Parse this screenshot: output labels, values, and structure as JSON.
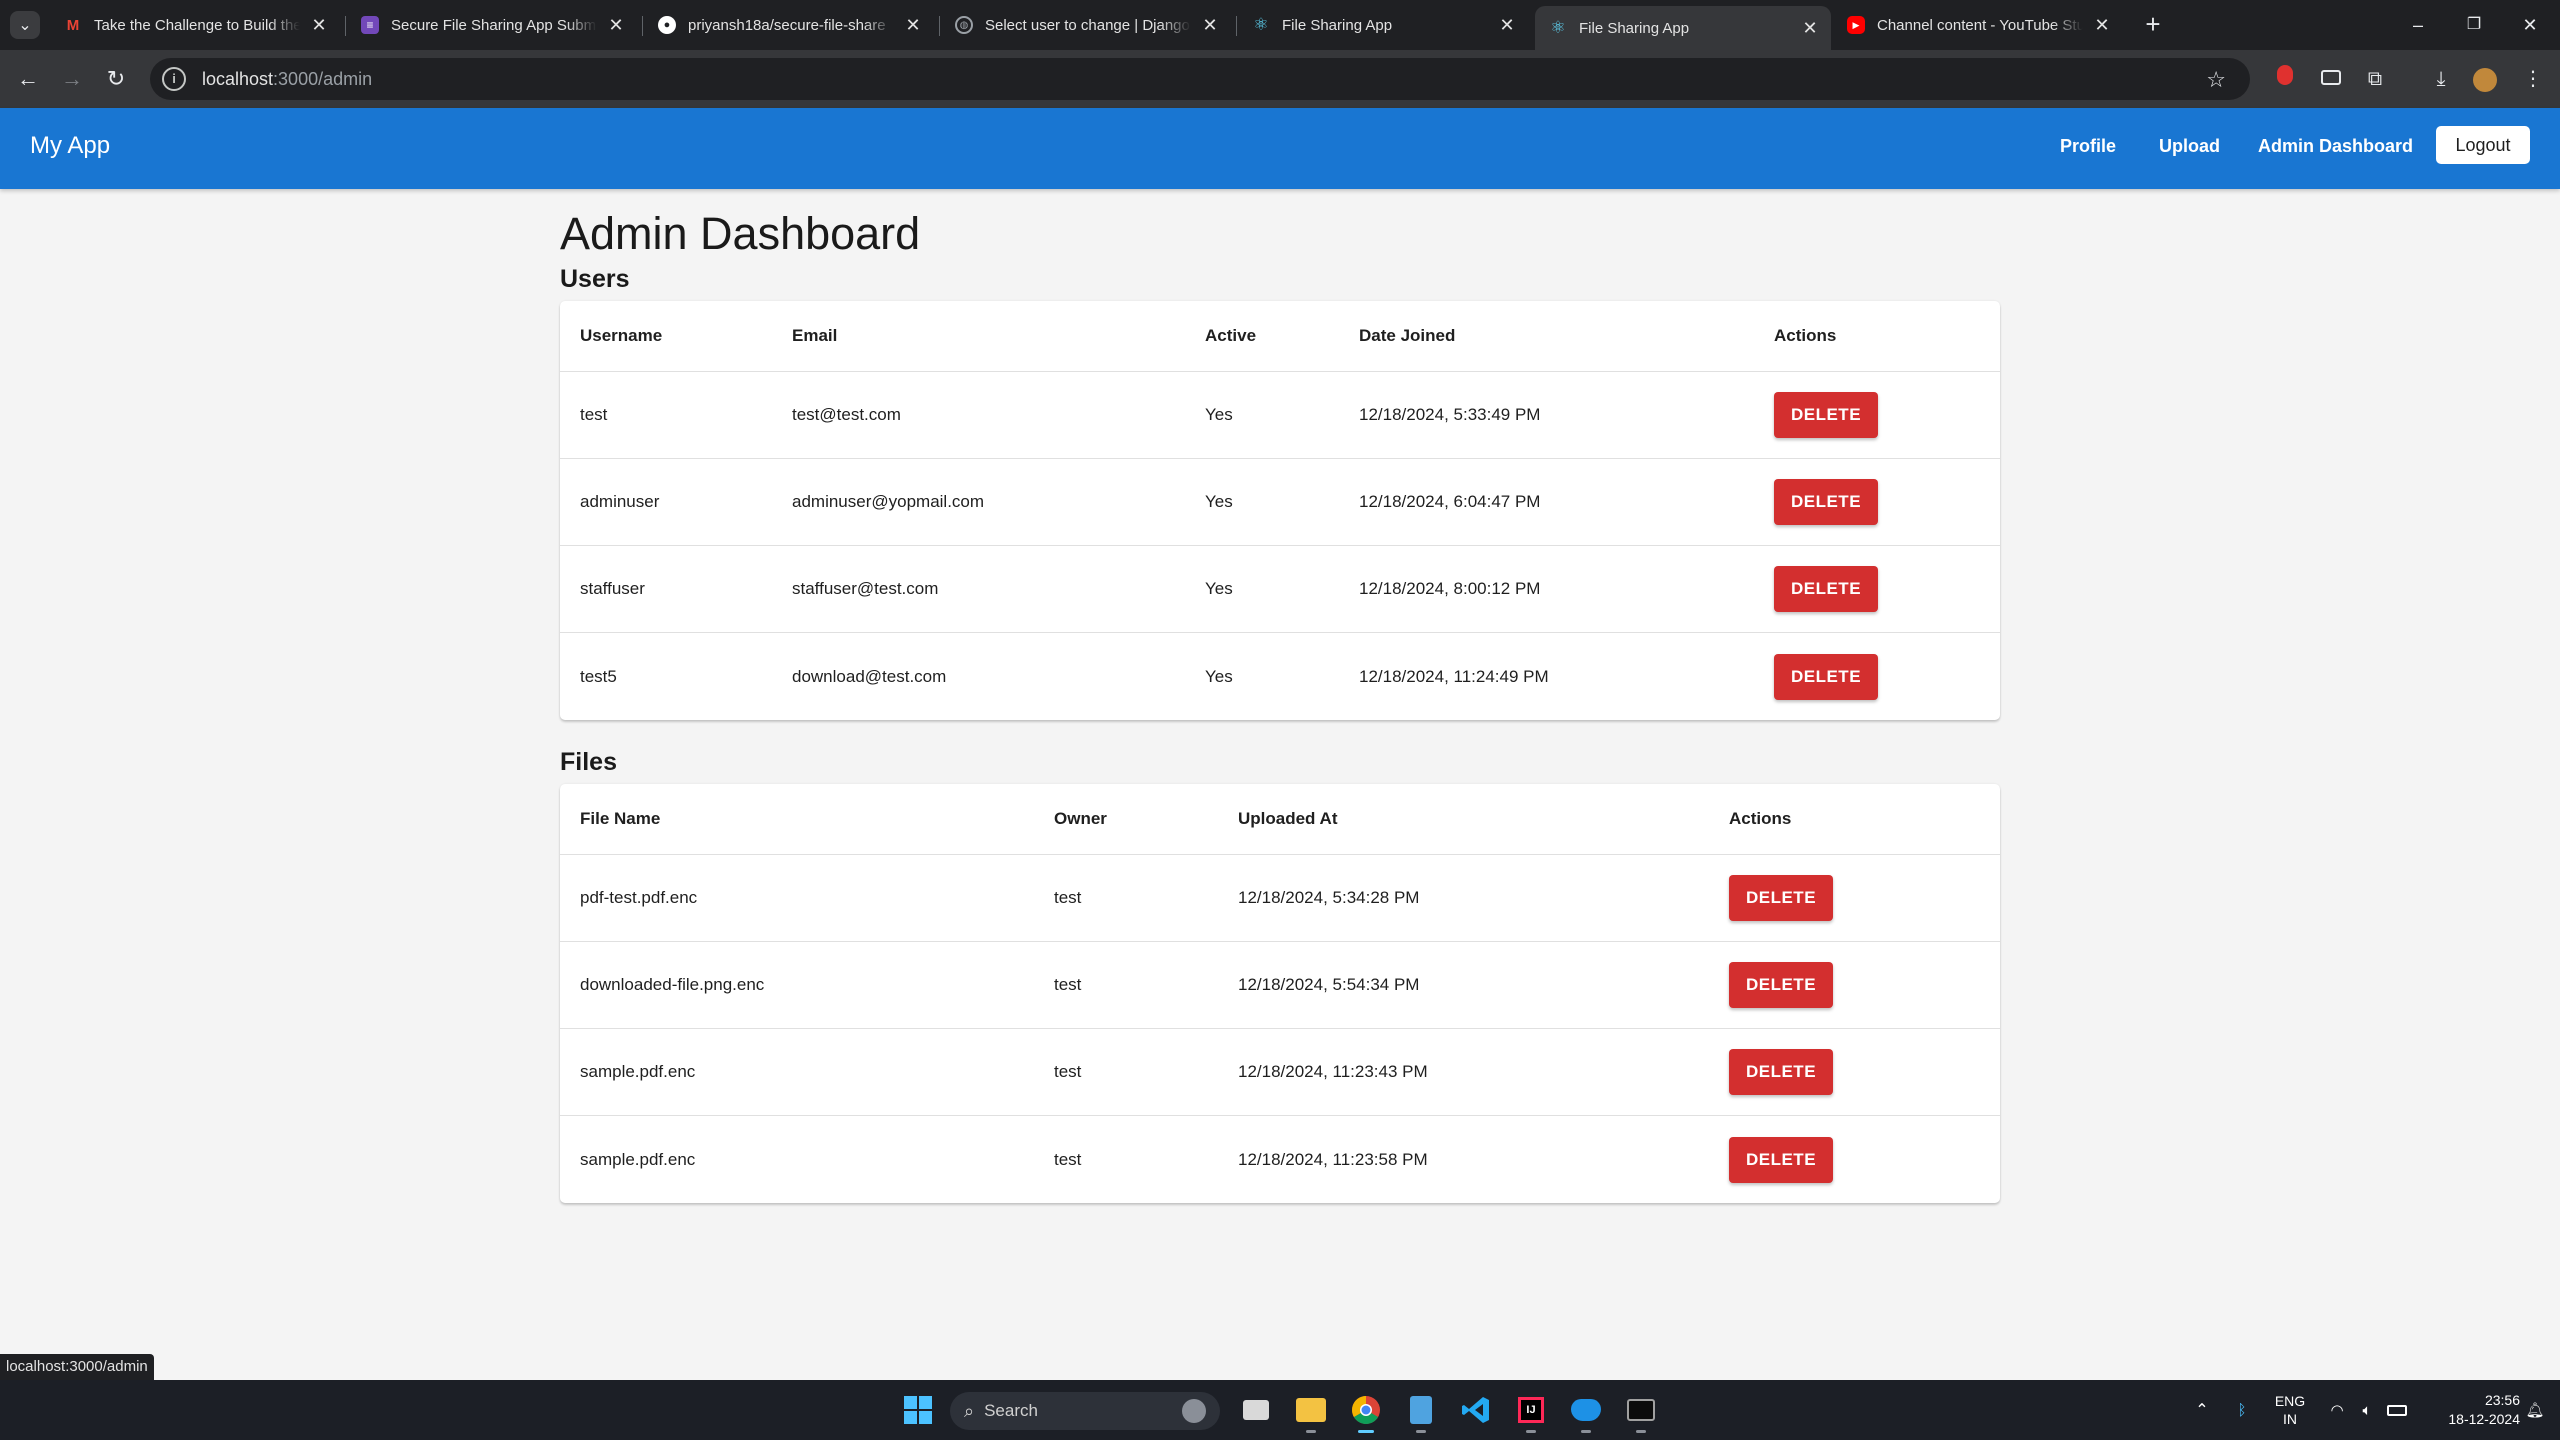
{
  "browser": {
    "tabs": [
      {
        "title": "Take the Challenge to Build the",
        "favicon": "gmail-icon",
        "color": "#ea4335",
        "glyph": "M"
      },
      {
        "title": "Secure File Sharing App Submis",
        "favicon": "forms-icon",
        "color": "#7248b9",
        "glyph": "≡"
      },
      {
        "title": "priyansh18a/secure-file-share",
        "favicon": "github-icon",
        "color": "#ffffff",
        "glyph": "●"
      },
      {
        "title": "Select user to change | Django s",
        "favicon": "globe-icon",
        "color": "#9aa0a6",
        "glyph": "◍"
      },
      {
        "title": "File Sharing App",
        "favicon": "react-icon",
        "color": "#61dafb",
        "glyph": "⚛"
      },
      {
        "title": "File Sharing App",
        "favicon": "react-icon",
        "color": "#61dafb",
        "glyph": "⚛"
      },
      {
        "title": "Channel content - YouTube Stud",
        "favicon": "youtube-icon",
        "color": "#ff0000",
        "glyph": "▶"
      }
    ],
    "active_tab_index": 5,
    "url_host": "localhost",
    "url_path": ":3000/admin",
    "status_url": "localhost:3000/admin"
  },
  "app": {
    "brand": "My App",
    "nav": {
      "profile": "Profile",
      "upload": "Upload",
      "admin": "Admin Dashboard",
      "logout": "Logout"
    },
    "page_title": "Admin Dashboard",
    "users": {
      "title": "Users",
      "headers": {
        "username": "Username",
        "email": "Email",
        "active": "Active",
        "date_joined": "Date Joined",
        "actions": "Actions"
      },
      "rows": [
        {
          "username": "test",
          "email": "test@test.com",
          "active": "Yes",
          "date_joined": "12/18/2024, 5:33:49 PM",
          "action": "DELETE"
        },
        {
          "username": "adminuser",
          "email": "adminuser@yopmail.com",
          "active": "Yes",
          "date_joined": "12/18/2024, 6:04:47 PM",
          "action": "DELETE"
        },
        {
          "username": "staffuser",
          "email": "staffuser@test.com",
          "active": "Yes",
          "date_joined": "12/18/2024, 8:00:12 PM",
          "action": "DELETE"
        },
        {
          "username": "test5",
          "email": "download@test.com",
          "active": "Yes",
          "date_joined": "12/18/2024, 11:24:49 PM",
          "action": "DELETE"
        }
      ]
    },
    "files": {
      "title": "Files",
      "headers": {
        "file_name": "File Name",
        "owner": "Owner",
        "uploaded_at": "Uploaded At",
        "actions": "Actions"
      },
      "rows": [
        {
          "file_name": "pdf-test.pdf.enc",
          "owner": "test",
          "uploaded_at": "12/18/2024, 5:34:28 PM",
          "action": "DELETE"
        },
        {
          "file_name": "downloaded-file.png.enc",
          "owner": "test",
          "uploaded_at": "12/18/2024, 5:54:34 PM",
          "action": "DELETE"
        },
        {
          "file_name": "sample.pdf.enc",
          "owner": "test",
          "uploaded_at": "12/18/2024, 11:23:43 PM",
          "action": "DELETE"
        },
        {
          "file_name": "sample.pdf.enc",
          "owner": "test",
          "uploaded_at": "12/18/2024, 11:23:58 PM",
          "action": "DELETE"
        }
      ]
    }
  },
  "taskbar": {
    "search_placeholder": "Search",
    "language": "ENG",
    "region": "IN",
    "time": "23:56",
    "date": "18-12-2024"
  },
  "colors": {
    "appbar": "#1976d2",
    "delete": "#d32f2f",
    "page_bg": "#f4f4f4"
  }
}
